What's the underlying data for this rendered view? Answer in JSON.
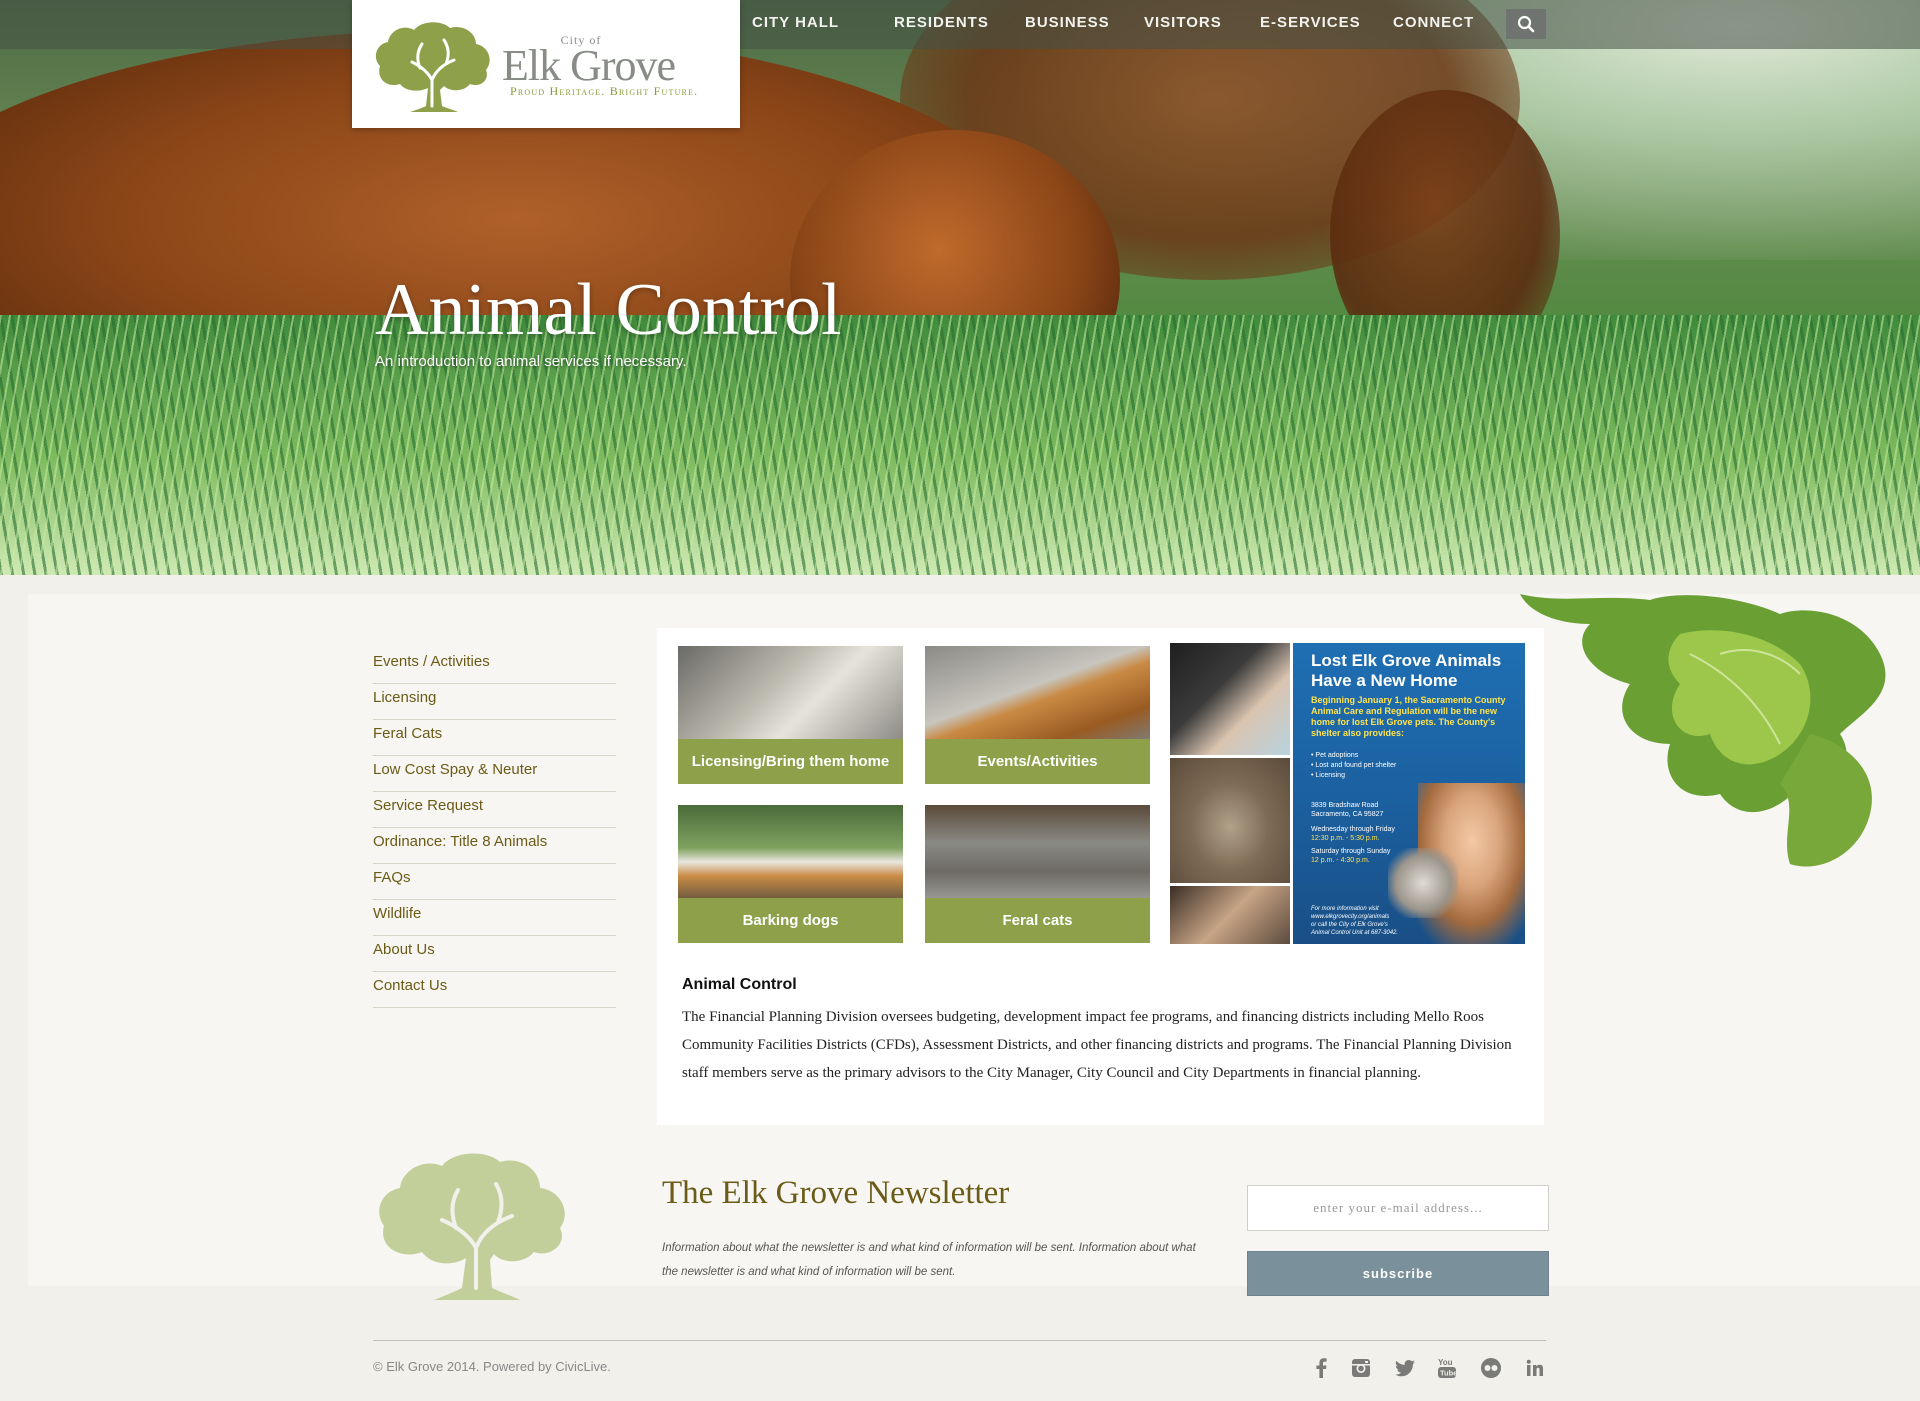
{
  "header": {
    "logo": {
      "city_of": "City of",
      "name": "Elk Grove",
      "tagline": "Proud Heritage. Bright Future."
    },
    "nav": [
      "CITY HALL",
      "RESIDENTS",
      "BUSINESS",
      "VISITORS",
      "E-SERVICES",
      "CONNECT"
    ],
    "search_icon": "search-icon"
  },
  "hero": {
    "title": "Animal Control",
    "subtitle": "An introduction to animal services if necessary."
  },
  "sidebar": {
    "items": [
      "Events / Activities",
      "Licensing",
      "Feral Cats",
      "Low Cost Spay & Neuter",
      "Service Request",
      "Ordinance: Title 8 Animals",
      "FAQs",
      "Wildlife",
      "About Us",
      "Contact Us"
    ]
  },
  "tiles": [
    {
      "label": "Licensing/Bring them home"
    },
    {
      "label": "Events/Activities"
    },
    {
      "label": "Barking dogs"
    },
    {
      "label": "Feral cats"
    }
  ],
  "poster": {
    "title": "Lost Elk Grove Animals Have a New Home",
    "intro": "Beginning January 1, the Sacramento County Animal Care and Regulation will be the new home for lost Elk Grove pets. The County's shelter also provides:",
    "list": [
      "• Pet adoptions",
      "• Lost and found pet shelter",
      "• Licensing"
    ],
    "address_line1": "3839 Bradshaw Road",
    "address_line2": "Sacramento, CA 95827",
    "hours1_label": "Wednesday through Friday",
    "hours1_time": "12:30 p.m. - 5:30 p.m.",
    "hours2_label": "Saturday through Sunday",
    "hours2_time": "12 p.m. - 4:30 p.m.",
    "contact_line1": "For more information visit",
    "contact_line2": "www.elkgrovecity.org/animals",
    "contact_line3": "or call the City of Elk Grove's",
    "contact_line4": "Animal Control Unit at 687-3042."
  },
  "article": {
    "title": "Animal Control",
    "body": "The Financial Planning Division oversees budgeting, development impact fee programs, and financing districts including Mello Roos Community Facilities Districts (CFDs), Assessment Districts, and other financing districts and programs. The Financial Planning Division staff members serve as the primary advisors to the City Manager, City Council and City Departments in financial planning."
  },
  "newsletter": {
    "title": "The Elk Grove Newsletter",
    "description": "Information about what the newsletter is and what kind of information will be sent. Information about what the newsletter is and what kind of information will be sent.",
    "email_placeholder": "enter your e-mail address...",
    "subscribe_label": "subscribe"
  },
  "footer": {
    "copyright": "© Elk Grove 2014. Powered by CivicLive.",
    "social_icons": [
      "facebook-icon",
      "instagram-icon",
      "twitter-icon",
      "youtube-icon",
      "flickr-icon",
      "linkedin-icon"
    ]
  },
  "colors": {
    "accent_green": "#8ea04a",
    "olive_text": "#6b5b17",
    "subscribe_button": "#7a909a",
    "poster_blue": "#1f6fb3"
  }
}
